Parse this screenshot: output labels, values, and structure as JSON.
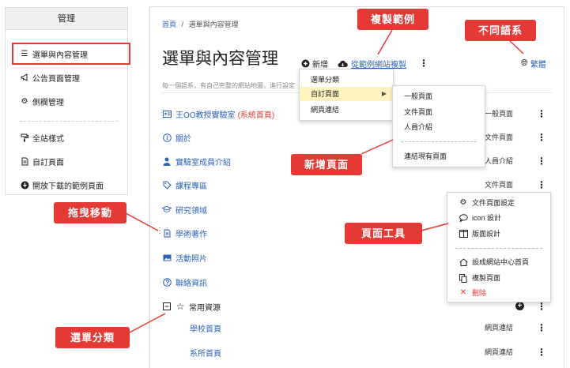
{
  "sidebar": {
    "title": "管理",
    "items": [
      {
        "label": "選單與內容管理",
        "icon": "list-icon"
      },
      {
        "label": "公告頁面管理",
        "icon": "megaphone-icon"
      },
      {
        "label": "側欄管理",
        "icon": "gear-icon"
      },
      {
        "label": "全站樣式",
        "icon": "paint-roller-icon"
      },
      {
        "label": "自訂頁面",
        "icon": "document-icon"
      },
      {
        "label": "開放下載的範例頁面",
        "icon": "download-circle-icon"
      }
    ]
  },
  "breadcrumb": {
    "home": "首頁",
    "separator": "/",
    "current": "選單與內容管理"
  },
  "page_title": "選單與內容管理",
  "toolbar": {
    "new_label": "新增",
    "copy_label": "從範例網站複製",
    "more": "⋮",
    "lang_label": "繁體"
  },
  "description": "每一個語系，有自己完整的網站地圖，進行設定",
  "menu_rows": [
    {
      "label": "王OO教授實驗室",
      "badge": "(系統首頁)",
      "type": "一般頁面",
      "icon": "id-card-icon"
    },
    {
      "label": "關於",
      "type": "文件頁面",
      "icon": "info-icon"
    },
    {
      "label": "實驗室成員介紹",
      "type": "人員介紹",
      "icon": "person-icon"
    },
    {
      "label": "課程專區",
      "type": "文件頁面",
      "icon": "tag-icon"
    },
    {
      "label": "研究領域",
      "type": "",
      "icon": "graduation-cap-icon"
    },
    {
      "label": "學術著作",
      "type": "",
      "icon": "document-icon"
    },
    {
      "label": "活動照片",
      "type": "",
      "icon": "image-icon"
    },
    {
      "label": "聯絡資訊",
      "type": "",
      "icon": "question-icon"
    },
    {
      "label": "常用資源",
      "type": "",
      "icon": "star-icon"
    },
    {
      "label": "學校首頁",
      "type": "網頁連結",
      "icon": ""
    },
    {
      "label": "系所首頁",
      "type": "網頁連結",
      "icon": ""
    }
  ],
  "new_menu": {
    "items": [
      "選單分類",
      "自訂頁面",
      "網頁連結"
    ]
  },
  "custom_submenu": {
    "items": [
      "一般頁面",
      "文件頁面",
      "人員介紹",
      "連結現有頁面"
    ]
  },
  "page_tools": {
    "items": [
      "文件頁面設定",
      "icon 設計",
      "版面設計",
      "設成網站中心首頁",
      "複製頁面",
      "刪除"
    ]
  },
  "callouts": {
    "copy_example": "複製範例",
    "languages": "不同語系",
    "drag_move": "拖曳移動",
    "new_page": "新增頁面",
    "page_tools": "頁面工具",
    "menu_category": "選單分類"
  },
  "colors": {
    "accent_red": "#e53935",
    "link_blue": "#2a63b8",
    "highlight": "#fff3bf"
  }
}
